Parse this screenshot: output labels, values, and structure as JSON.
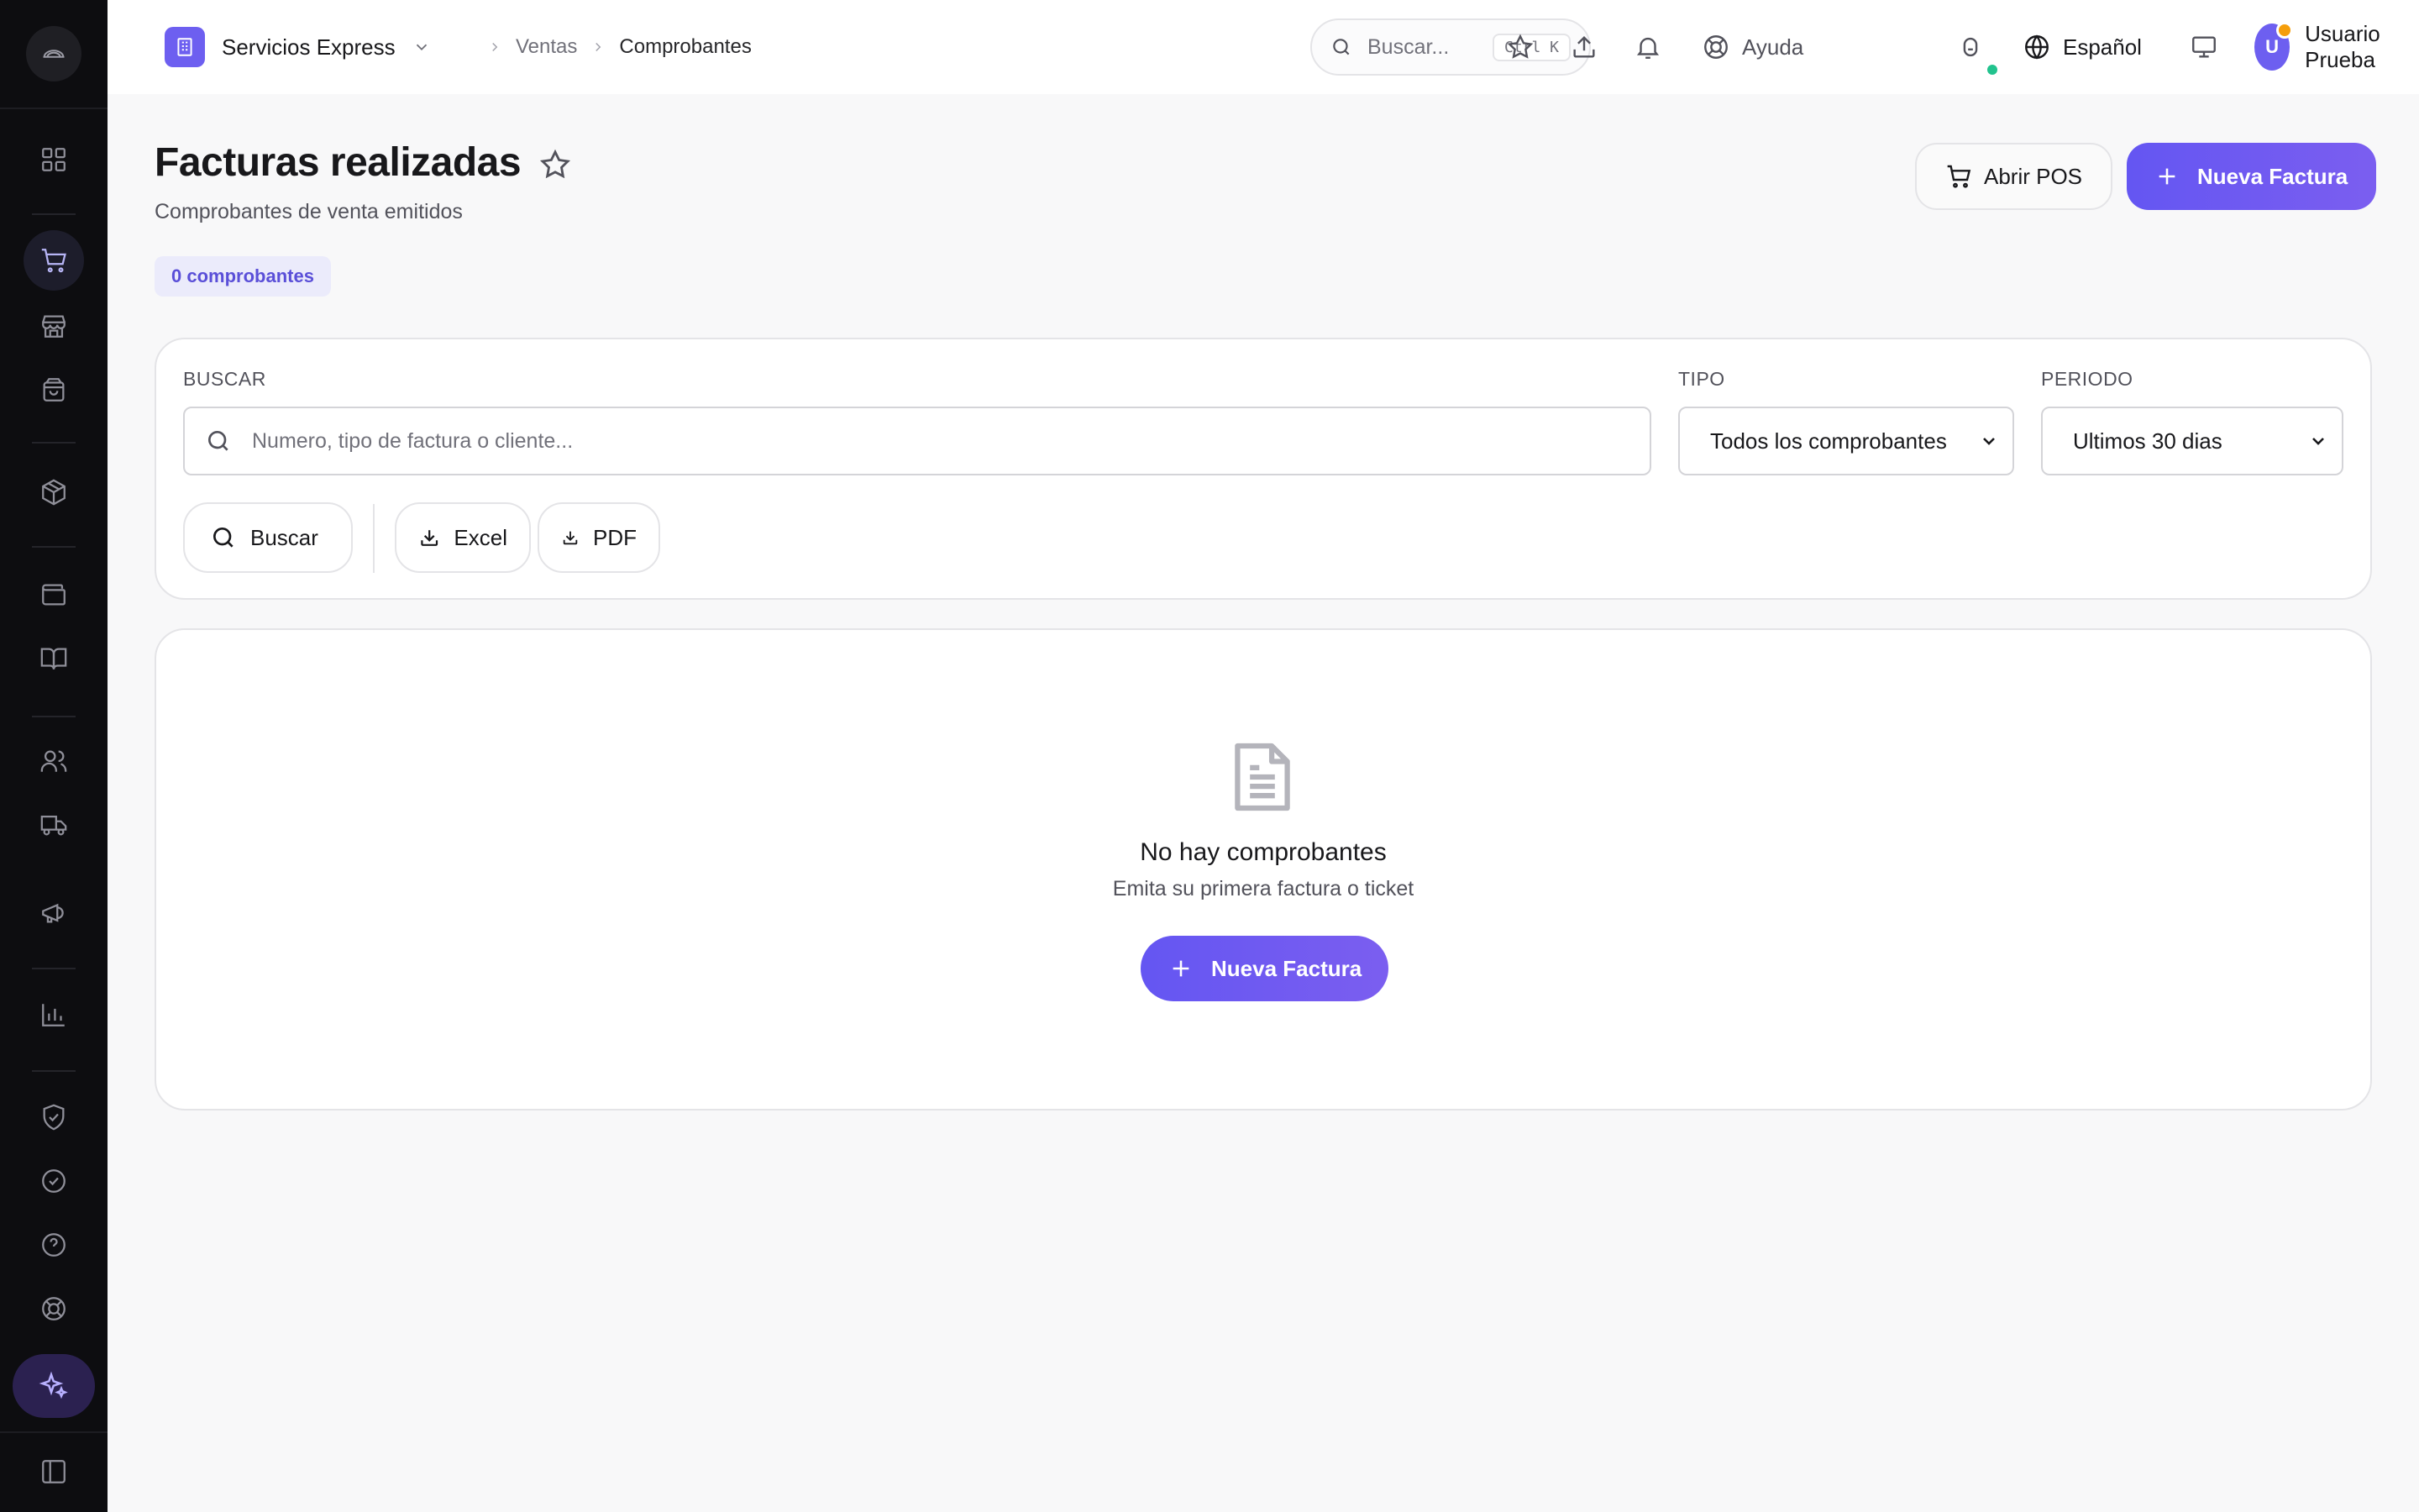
{
  "brand": {
    "name": "Servicios Express"
  },
  "breadcrumb": {
    "parent": "Ventas",
    "current": "Comprobantes"
  },
  "topbar": {
    "search_placeholder": "Buscar...",
    "search_shortcut": "Ctrl K",
    "help_label": "Ayuda",
    "language_label": "Español",
    "user_initial": "U",
    "user_name": "Usuario Prueba"
  },
  "page": {
    "title": "Facturas realizadas",
    "subtitle": "Comprobantes de venta emitidos",
    "count_badge": "0 comprobantes",
    "open_pos_label": "Abrir POS",
    "new_invoice_label": "Nueva Factura"
  },
  "filters": {
    "search_label": "BUSCAR",
    "search_placeholder": "Numero, tipo de factura o cliente...",
    "type_label": "TIPO",
    "type_value": "Todos los comprobantes",
    "period_label": "PERIODO",
    "period_value": "Ultimos 30 dias",
    "search_button": "Buscar",
    "excel_button": "Excel",
    "pdf_button": "PDF"
  },
  "empty_state": {
    "title": "No hay comprobantes",
    "subtitle": "Emita su primera factura o ticket",
    "button": "Nueva Factura"
  },
  "colors": {
    "accent": "#6d5ff0",
    "sidebar_bg": "#0d0d10",
    "online": "#22c38e",
    "notification": "#f59e0b"
  }
}
